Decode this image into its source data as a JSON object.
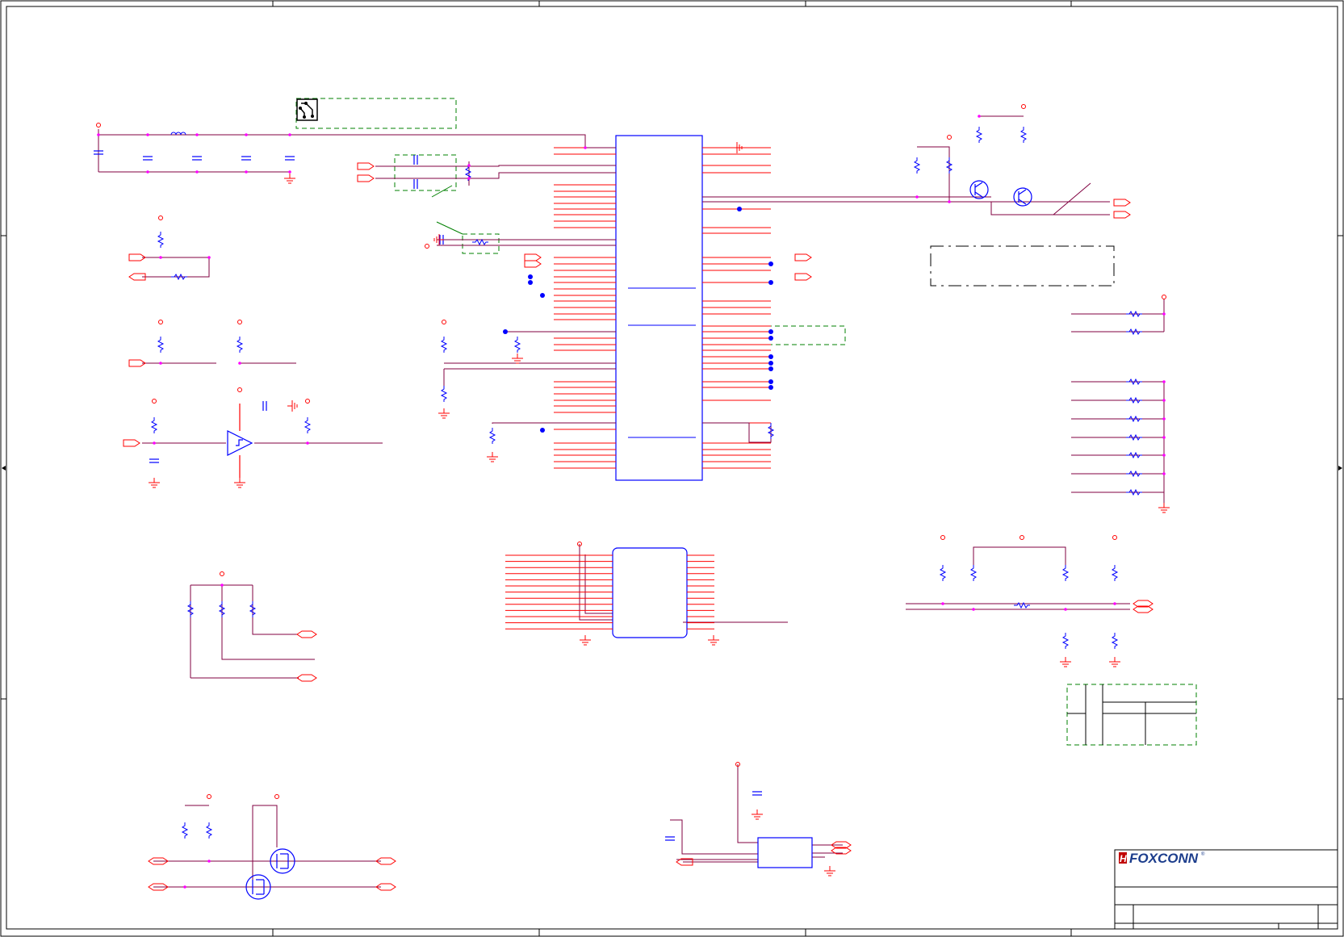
{
  "colors": {
    "wire": "#800040",
    "pin": "#ff0000",
    "component": "#0000ff",
    "junction": "#ff00ff",
    "dashed_box": "#008000",
    "frame": "#000000",
    "dot": "#0000ff"
  },
  "title_block": {
    "company_logo_text": "FOXCONN",
    "logo_mark": "H",
    "registered_mark": "®"
  },
  "icons": {
    "drawing_note_icon": "pcb-note-icon"
  }
}
